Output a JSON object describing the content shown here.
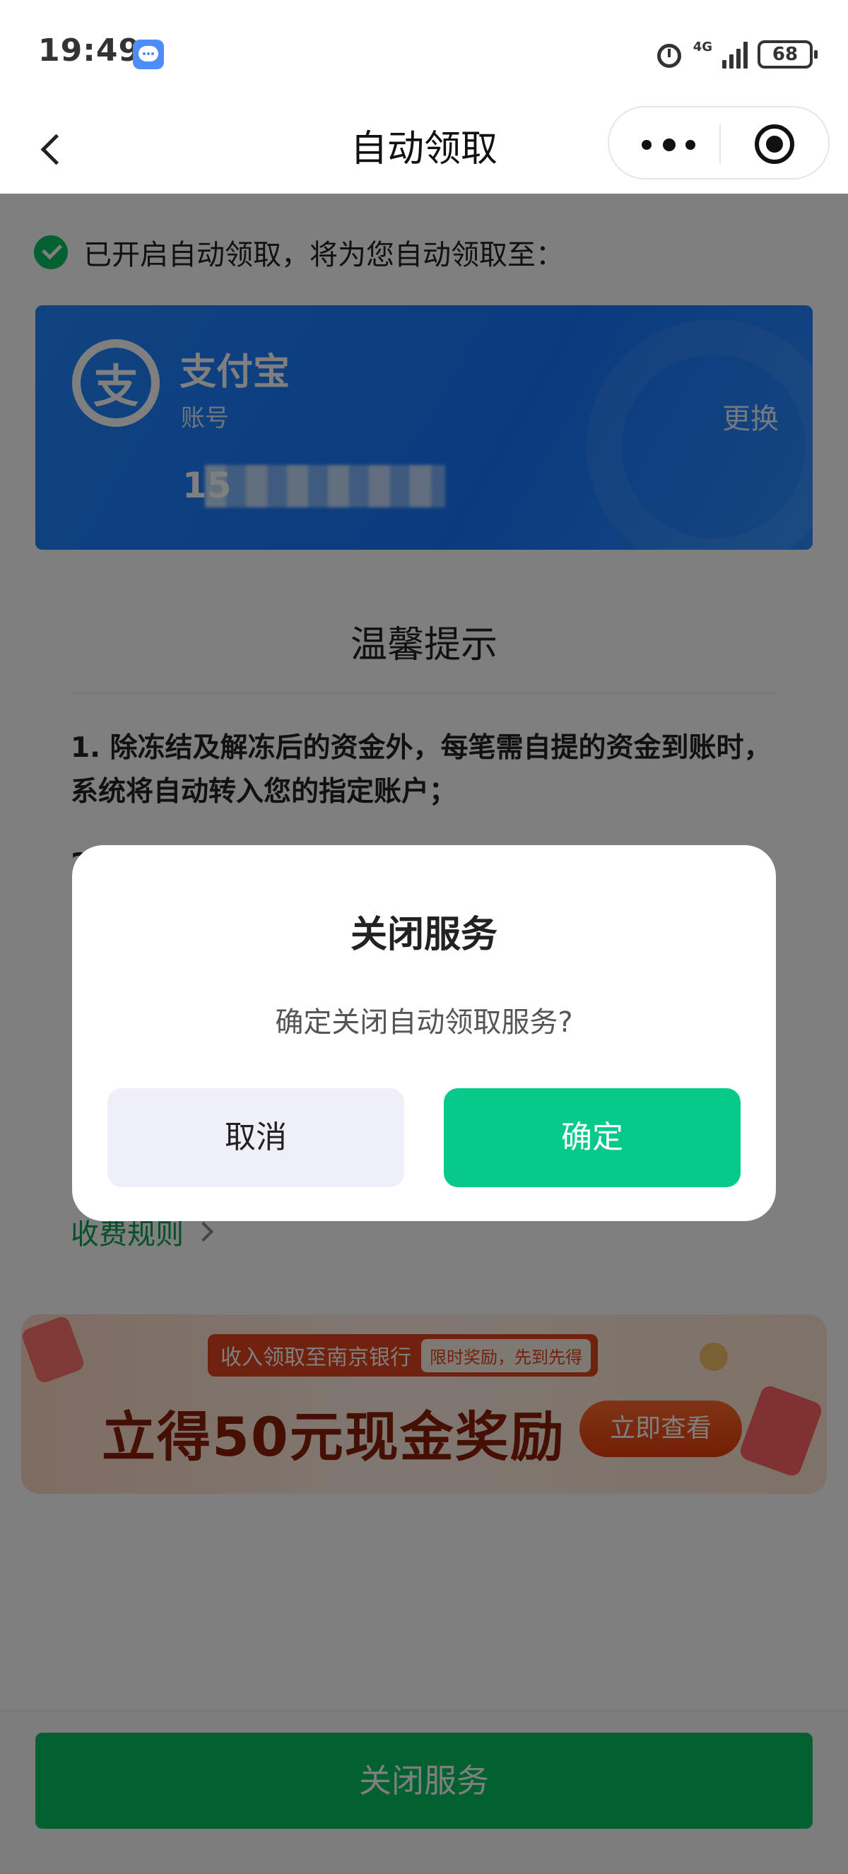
{
  "status_bar": {
    "time": "19:49",
    "network": "4G",
    "battery": "68",
    "icons": [
      "message-icon",
      "alarm-icon",
      "signal-icon",
      "battery-icon"
    ]
  },
  "nav": {
    "title": "自动领取",
    "back_icon": "chevron-left-icon",
    "more_icon": "more-dots-icon",
    "close_icon": "target-circle-icon"
  },
  "notice": {
    "text": "已开启自动领取，将为您自动领取至："
  },
  "account_card": {
    "name": "支付宝",
    "logo_glyph": "支",
    "subtitle": "账号",
    "account_prefix": "15",
    "change_label": "更换",
    "color": "#1677ff"
  },
  "tips": {
    "title": "温馨提示",
    "items": [
      "1. 除冻结及解冻后的资金外，每笔需自提的资金到账时，系统将自动转入您的指定账户；",
      "2"
    ],
    "fee_link": "收费规则"
  },
  "banner": {
    "tag": "收入领取至南京银行",
    "tag_badge": "限时奖励，先到先得",
    "headline": "立得50元现金奖励",
    "button": "立即查看"
  },
  "bottom_button": {
    "label": "关闭服务",
    "color": "#07c160"
  },
  "dialog": {
    "title": "关闭服务",
    "message": "确定关闭自动领取服务?",
    "cancel_label": "取消",
    "confirm_label": "确定",
    "confirm_color": "#07c98a"
  }
}
